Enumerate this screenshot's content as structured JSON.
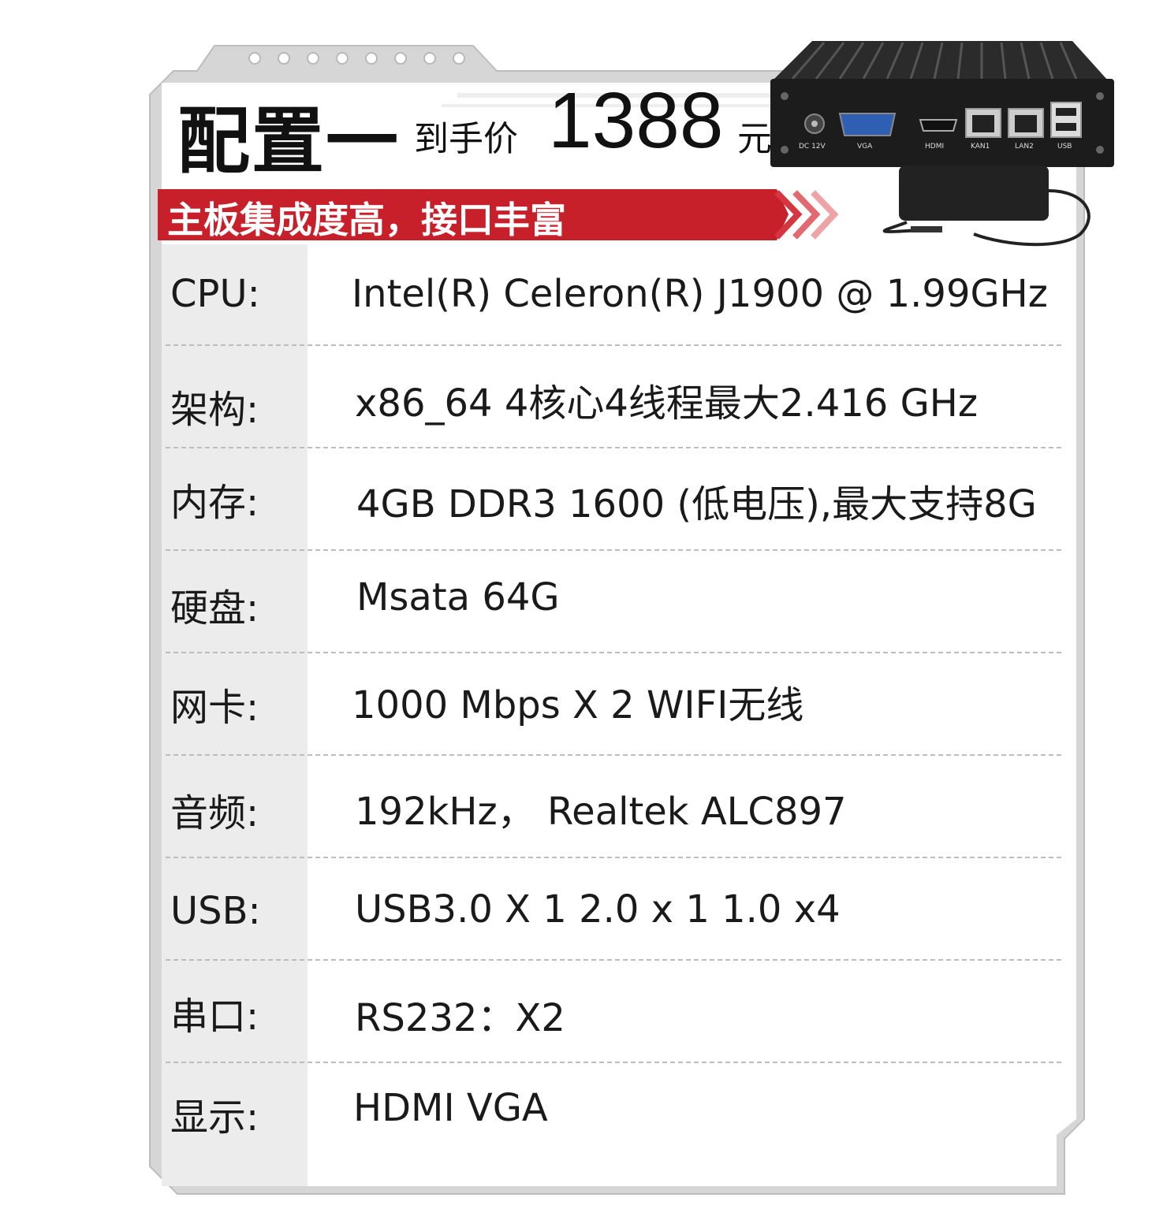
{
  "header": {
    "title": "配置一",
    "price_label": "到手价",
    "price_value": "1388",
    "price_unit": "元"
  },
  "banner": {
    "text": "主板集成度高，接口丰富"
  },
  "product_ports": [
    "DC 12V",
    "VGA",
    "HDMI",
    "KAN1",
    "LAN2",
    "USB"
  ],
  "specs": [
    {
      "label": "CPU:",
      "value": "Intel(R) Celeron(R)  J1900 @ 1.99GHz"
    },
    {
      "label": "架构:",
      "value": "x86_64 4核心4线程最大2.416 GHz"
    },
    {
      "label": "内存:",
      "value": "4GB DDR3 1600 (低电压),最大支持8G"
    },
    {
      "label": "硬盘:",
      "value": "Msata  64G"
    },
    {
      "label": "网卡:",
      "value": "1000 Mbps X 2  WIFI无线"
    },
    {
      "label": "音频:",
      "value": "192kHz， Realtek ALC897"
    },
    {
      "label": "USB:",
      "value": "USB3.0 X 1 2.0 x 1 1.0 x4"
    },
    {
      "label": "串口:",
      "value": "RS232：X2"
    },
    {
      "label": "显示:",
      "value": "HDMI VGA"
    }
  ],
  "colors": {
    "banner_red": "#c8202a",
    "frame_grey": "#cfcfcf",
    "label_column_bg": "#ececec",
    "text": "#1a1a1a"
  }
}
